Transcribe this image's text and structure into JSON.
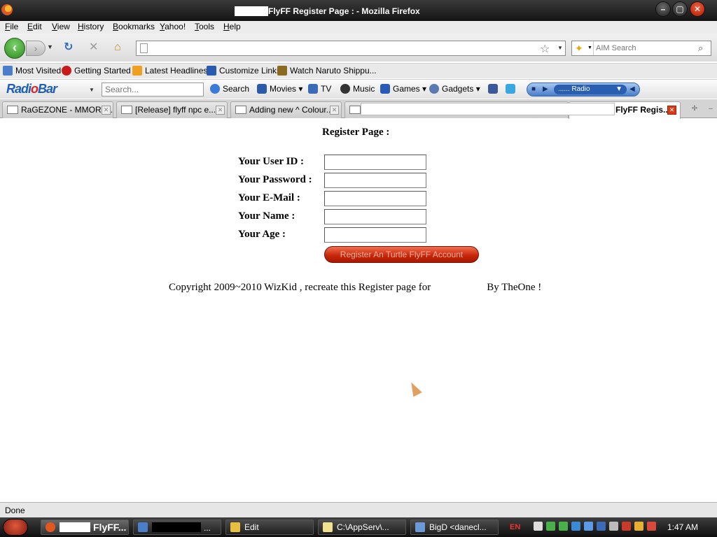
{
  "window": {
    "title": "FlyFF Register Page : - Mozilla Firefox"
  },
  "menu": [
    "File",
    "Edit",
    "View",
    "History",
    "Bookmarks",
    "Yahoo!",
    "Tools",
    "Help"
  ],
  "navbar": {
    "url": "",
    "search_placeholder": "AIM Search"
  },
  "bookmarks": [
    "Most Visited",
    "Getting Started",
    "Latest Headlines",
    "Customize Links",
    "Watch Naruto Shippu..."
  ],
  "radiobar": {
    "logo_pre": "Radi",
    "logo_o": "o",
    "logo_post": "Bar",
    "search_placeholder": "Search...",
    "search_label": "Search",
    "items": [
      "Movies",
      "TV",
      "Music",
      "Games",
      "Gadgets"
    ],
    "station": "...... Radio"
  },
  "tabs": [
    {
      "label": "RaGEZONE - MMORP...",
      "active": false
    },
    {
      "label": "[Release] flyff npc e...",
      "active": false
    },
    {
      "label": "Adding new ^ Colour...",
      "active": false
    },
    {
      "label": "FlyFF Regis...",
      "active": true
    }
  ],
  "page": {
    "heading": "Register Page :",
    "fields": [
      {
        "label": "Your User ID :",
        "value": ""
      },
      {
        "label": "Your Password :",
        "value": ""
      },
      {
        "label": "Your E-Mail :",
        "value": ""
      },
      {
        "label": "Your Name :",
        "value": ""
      },
      {
        "label": "Your Age :",
        "value": ""
      }
    ],
    "submit_label": "Register An Turtle FlyFF Account",
    "copyright_pre": "Copyright 2009~2010 WizKid , recreate this Register page for",
    "copyright_post": "By TheOne !"
  },
  "status": "Done",
  "taskbar": {
    "tasks": [
      "FlyFF...",
      "...",
      "Edit",
      "C:\\AppServ\\...",
      "BigD <danecl..."
    ],
    "lang": "EN",
    "clock": "1:47 AM"
  },
  "colors": {
    "register_button": "#c8280a",
    "back_button": "#2c8a1c",
    "active_tab_close": "#d83a1a"
  },
  "icons": [
    "firefox-icon",
    "back-arrow-icon",
    "forward-arrow-icon",
    "reload-icon",
    "stop-icon",
    "home-icon",
    "star-icon",
    "search-icon",
    "mouse-cursor-icon"
  ]
}
